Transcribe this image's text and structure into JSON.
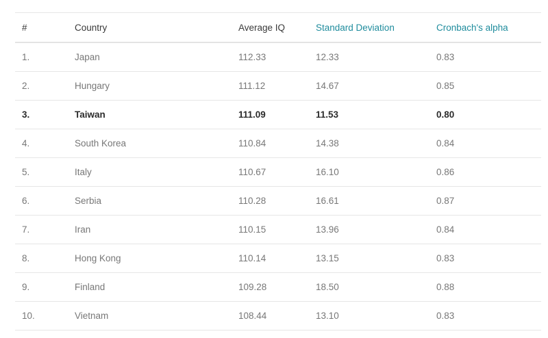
{
  "table": {
    "columns": [
      "#",
      "Country",
      "Average IQ",
      "Standard Deviation",
      "Cronbach's alpha"
    ],
    "rows": [
      [
        "1.",
        "Japan",
        "112.33",
        "12.33",
        "0.83"
      ],
      [
        "2.",
        "Hungary",
        "111.12",
        "14.67",
        "0.85"
      ],
      [
        "3.",
        "Taiwan",
        "111.09",
        "11.53",
        "0.80"
      ],
      [
        "4.",
        "South Korea",
        "110.84",
        "14.38",
        "0.84"
      ],
      [
        "5.",
        "Italy",
        "110.67",
        "16.10",
        "0.86"
      ],
      [
        "6.",
        "Serbia",
        "110.28",
        "16.61",
        "0.87"
      ],
      [
        "7.",
        "Iran",
        "110.15",
        "13.96",
        "0.84"
      ],
      [
        "8.",
        "Hong Kong",
        "110.14",
        "13.15",
        "0.83"
      ],
      [
        "9.",
        "Finland",
        "109.28",
        "18.50",
        "0.88"
      ],
      [
        "10.",
        "Vietnam",
        "108.44",
        "13.10",
        "0.83"
      ]
    ],
    "highlighted_row": 2
  },
  "colors": {
    "link": "#1f8c9d",
    "text": "#777777",
    "header_text": "#3a3a3a",
    "highlight_text": "#2b2b2b",
    "divider": "#e6e6e6"
  }
}
